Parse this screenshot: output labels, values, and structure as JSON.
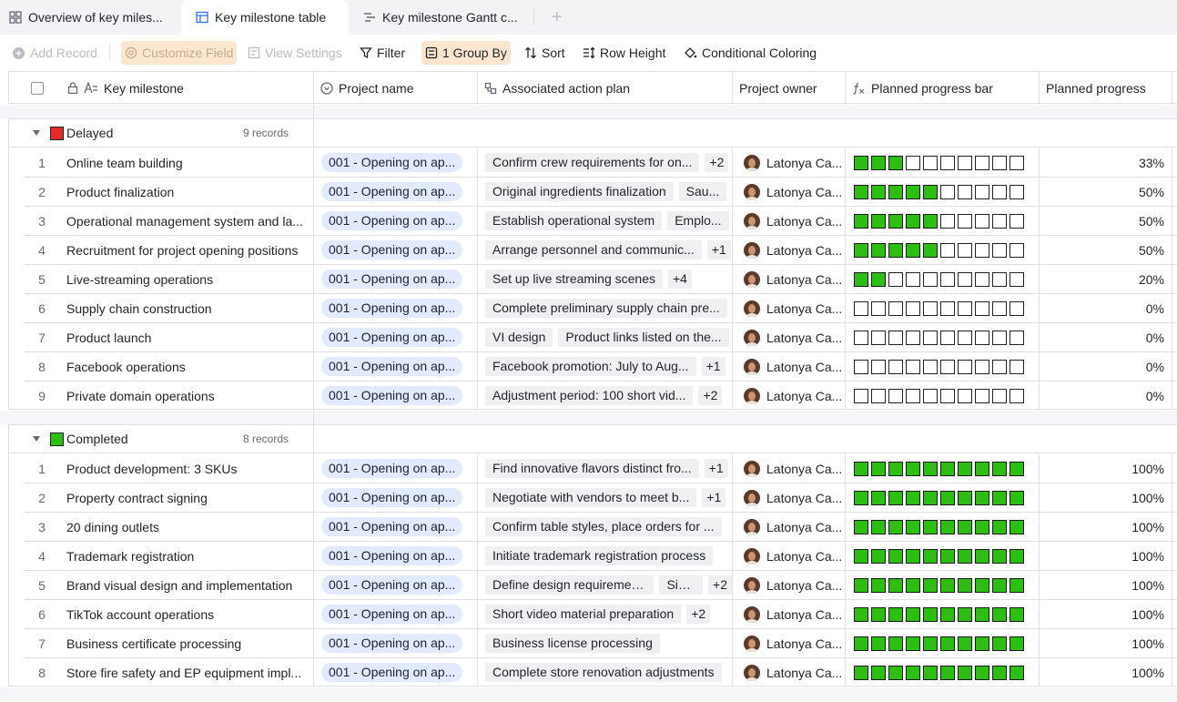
{
  "tabs": [
    {
      "label": "Overview of key miles...",
      "icon": "grid-icon"
    },
    {
      "label": "Key milestone table",
      "icon": "table-icon"
    },
    {
      "label": "Key milestone Gantt c...",
      "icon": "gantt-icon"
    }
  ],
  "toolbar": {
    "add_record": "Add Record",
    "customize_field": "Customize Field",
    "view_settings": "View Settings",
    "filter": "Filter",
    "group_by": "1 Group By",
    "sort": "Sort",
    "row_height": "Row Height",
    "conditional_coloring": "Conditional Coloring"
  },
  "columns": {
    "milestone": "Key milestone",
    "project": "Project name",
    "plan": "Associated action plan",
    "owner": "Project owner",
    "bar": "Planned progress bar",
    "progress": "Planned progress"
  },
  "colors": {
    "delayed": "#e22b2b",
    "completed": "#2ebd13",
    "accent": "#3370ff"
  },
  "groups": [
    {
      "name": "Delayed",
      "count": "9 records",
      "rows": [
        {
          "num": "1",
          "name": "Online team building",
          "project": "001 - Opening on ap...",
          "plans": [
            "Confirm crew requirements for on..."
          ],
          "more": "+2",
          "owner": "Latonya Ca...",
          "progress_fraction": 0.33,
          "progress": "33%"
        },
        {
          "num": "2",
          "name": "Product finalization",
          "project": "001 - Opening on ap...",
          "plans": [
            "Original ingredients finalization",
            "Sau..."
          ],
          "more": "",
          "owner": "Latonya Ca...",
          "progress_fraction": 0.5,
          "progress": "50%"
        },
        {
          "num": "3",
          "name": "Operational management system and la...",
          "project": "001 - Opening on ap...",
          "plans": [
            "Establish operational system",
            "Emplo..."
          ],
          "more": "",
          "owner": "Latonya Ca...",
          "progress_fraction": 0.5,
          "progress": "50%"
        },
        {
          "num": "4",
          "name": "Recruitment for project opening positions",
          "project": "001 - Opening on ap...",
          "plans": [
            "Arrange personnel and communic..."
          ],
          "more": "+1",
          "owner": "Latonya Ca...",
          "progress_fraction": 0.5,
          "progress": "50%"
        },
        {
          "num": "5",
          "name": "Live-streaming operations",
          "project": "001 - Opening on ap...",
          "plans": [
            "Set up live streaming scenes"
          ],
          "more": "+4",
          "owner": "Latonya Ca...",
          "progress_fraction": 0.2,
          "progress": "20%"
        },
        {
          "num": "6",
          "name": "Supply chain construction",
          "project": "001 - Opening on ap...",
          "plans": [
            "Complete preliminary supply chain pre..."
          ],
          "more": "",
          "owner": "Latonya Ca...",
          "progress_fraction": 0,
          "progress": "0%"
        },
        {
          "num": "7",
          "name": "Product launch",
          "project": "001 - Opening on ap...",
          "plans": [
            "VI design",
            "Product links listed on the..."
          ],
          "more": "",
          "owner": "Latonya Ca...",
          "progress_fraction": 0,
          "progress": "0%"
        },
        {
          "num": "8",
          "name": "Facebook operations",
          "project": "001 - Opening on ap...",
          "plans": [
            "Facebook promotion: July to Aug..."
          ],
          "more": "+1",
          "owner": "Latonya Ca...",
          "progress_fraction": 0,
          "progress": "0%"
        },
        {
          "num": "9",
          "name": "Private domain operations",
          "project": "001 - Opening on ap...",
          "plans": [
            "Adjustment period: 100 short vid..."
          ],
          "more": "+2",
          "owner": "Latonya Ca...",
          "progress_fraction": 0,
          "progress": "0%"
        }
      ]
    },
    {
      "name": "Completed",
      "count": "8 records",
      "rows": [
        {
          "num": "1",
          "name": "Product development: 3 SKUs",
          "project": "001 - Opening on ap...",
          "plans": [
            "Find innovative flavors distinct fro..."
          ],
          "more": "+1",
          "owner": "Latonya Ca...",
          "progress_fraction": 1,
          "progress": "100%"
        },
        {
          "num": "2",
          "name": "Property contract signing",
          "project": "001 - Opening on ap...",
          "plans": [
            "Negotiate with vendors to meet b..."
          ],
          "more": "+1",
          "owner": "Latonya Ca...",
          "progress_fraction": 1,
          "progress": "100%"
        },
        {
          "num": "3",
          "name": "20 dining outlets",
          "project": "001 - Opening on ap...",
          "plans": [
            "Confirm table styles, place orders for ..."
          ],
          "more": "",
          "owner": "Latonya Ca...",
          "progress_fraction": 1,
          "progress": "100%"
        },
        {
          "num": "4",
          "name": "Trademark registration",
          "project": "001 - Opening on ap...",
          "plans": [
            "Initiate trademark registration process"
          ],
          "more": "",
          "owner": "Latonya Ca...",
          "progress_fraction": 1,
          "progress": "100%"
        },
        {
          "num": "5",
          "name": "Brand visual design and implementation",
          "project": "001 - Opening on ap...",
          "plans": [
            "Define design requirements",
            "Sig..."
          ],
          "more": "+2",
          "owner": "Latonya Ca...",
          "progress_fraction": 1,
          "progress": "100%"
        },
        {
          "num": "6",
          "name": "TikTok account operations",
          "project": "001 - Opening on ap...",
          "plans": [
            "Short video material preparation"
          ],
          "more": "+2",
          "owner": "Latonya Ca...",
          "progress_fraction": 1,
          "progress": "100%"
        },
        {
          "num": "7",
          "name": "Business certificate processing",
          "project": "001 - Opening on ap...",
          "plans": [
            "Business license processing"
          ],
          "more": "",
          "owner": "Latonya Ca...",
          "progress_fraction": 1,
          "progress": "100%"
        },
        {
          "num": "8",
          "name": "Store fire safety and EP equipment impl...",
          "project": "001 - Opening on ap...",
          "plans": [
            "Complete store renovation adjustments"
          ],
          "more": "",
          "owner": "Latonya Ca...",
          "progress_fraction": 1,
          "progress": "100%"
        }
      ]
    }
  ]
}
